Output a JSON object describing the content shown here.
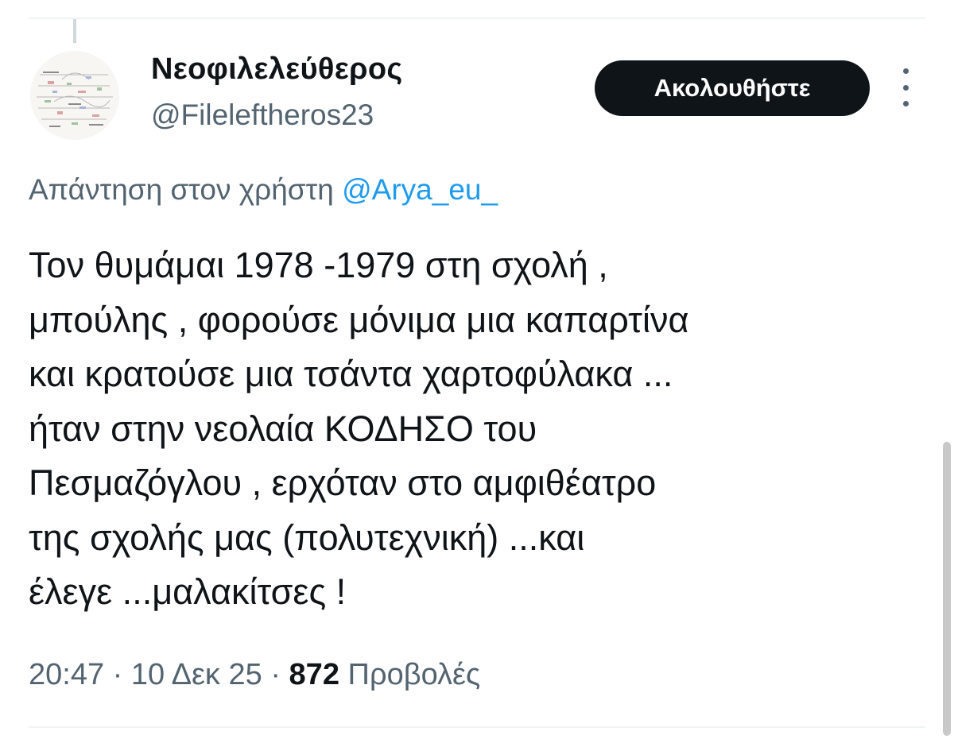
{
  "author": {
    "display_name": "Νεοφιλελεύθερος",
    "handle": "@Fileleftheros23"
  },
  "header": {
    "follow_label": "Ακολουθήστε"
  },
  "reply_context": {
    "prefix": "Απάντηση στον χρήστη",
    "mention": "@Arya_eu_"
  },
  "tweet": {
    "lines": [
      "Τον θυμάμαι 1978 -1979 στη σχολή ,",
      "μπούλης , φορούσε μόνιμα μια καπαρτίνα",
      "και κρατούσε μια τσάντα χαρτοφύλακα ...",
      "ήταν στην νεολαία ΚΟΔΗΣΟ του",
      "Πεσμαζόγλου , ερχόταν στο αμφιθέατρο",
      "της σχολής μας (πολυτεχνική) ...και",
      "έλεγε ...μαλακίτσες !"
    ]
  },
  "meta": {
    "time": "20:47",
    "date": "10 Δεκ 25",
    "views_count": "872",
    "views_label": "Προβολές",
    "separator": "·"
  },
  "colors": {
    "text_primary": "#0f1419",
    "text_secondary": "#536471",
    "link": "#1d9bf0",
    "button_bg": "#0f1419",
    "divider": "#eff3f4"
  },
  "icons": {
    "more": "more-vertical-icon"
  }
}
